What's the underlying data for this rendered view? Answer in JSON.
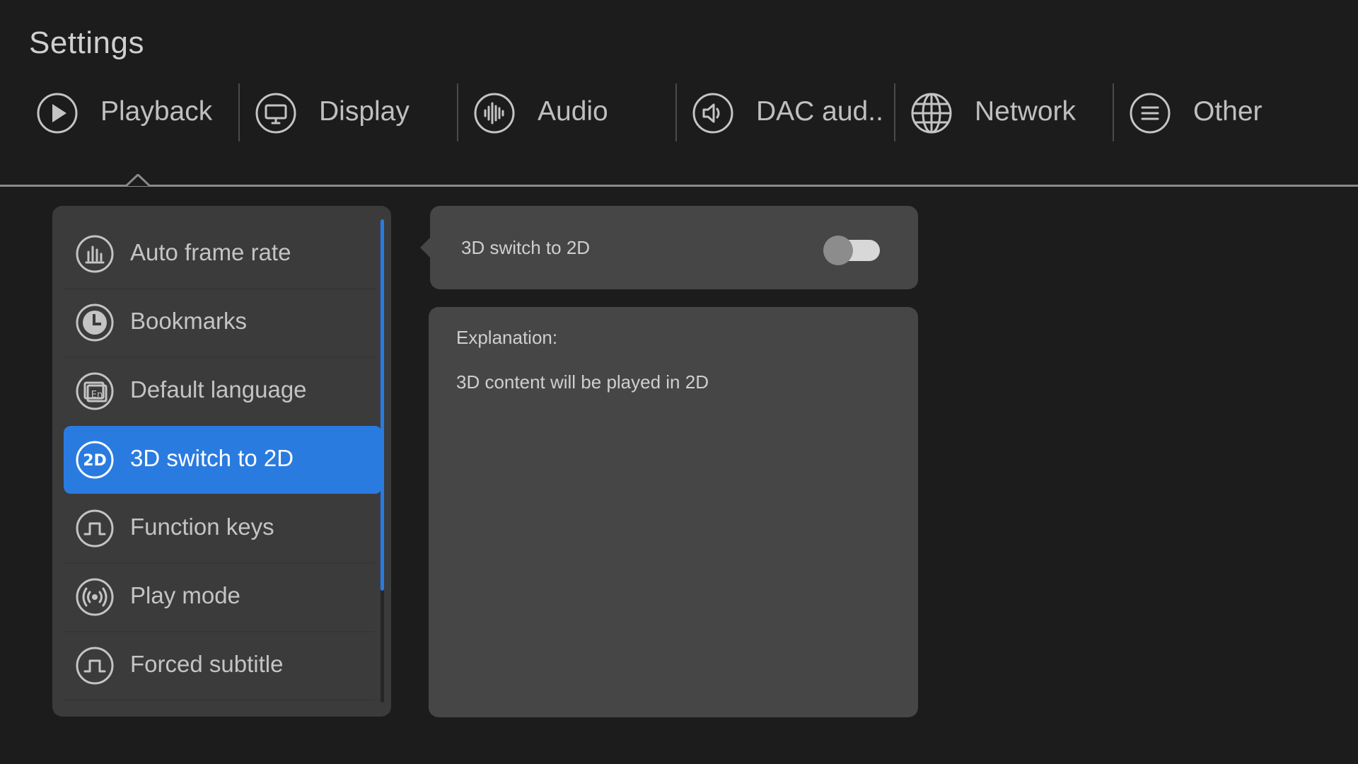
{
  "title": "Settings",
  "tabs": [
    {
      "label": "Playback",
      "icon": "play-icon",
      "selected": true
    },
    {
      "label": "Display",
      "icon": "monitor-icon"
    },
    {
      "label": "Audio",
      "icon": "audio-wave-icon"
    },
    {
      "label": "DAC aud..",
      "icon": "speaker-icon"
    },
    {
      "label": "Network",
      "icon": "globe-icon"
    },
    {
      "label": "Other",
      "icon": "menu-lines-icon"
    }
  ],
  "menu": {
    "items": [
      {
        "label": "Auto frame rate",
        "icon": "bar-chart-icon"
      },
      {
        "label": "Bookmarks",
        "icon": "clock-icon"
      },
      {
        "label": "Default language",
        "icon": "language-icon"
      },
      {
        "label": "3D switch to 2D",
        "icon": "2d-icon",
        "selected": true
      },
      {
        "label": "Function keys",
        "icon": "pulse-key-icon"
      },
      {
        "label": "Play mode",
        "icon": "broadcast-icon"
      },
      {
        "label": "Forced subtitle",
        "icon": "pulse-key-icon"
      }
    ],
    "icon_2d_text": "2D",
    "icon_lang_text": "En"
  },
  "detail": {
    "setting_label": "3D switch to 2D",
    "toggle_on": false,
    "explanation_title": "Explanation:",
    "explanation_text": "3D content will be played in 2D"
  },
  "colors": {
    "background": "#1c1c1c",
    "panel": "#3b3b3b",
    "card": "#464646",
    "accent": "#2a7be0",
    "text": "#c4c4c4"
  }
}
